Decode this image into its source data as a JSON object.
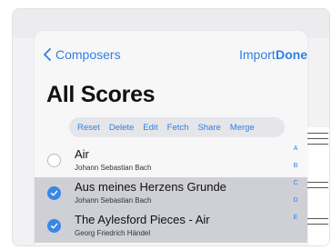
{
  "nav": {
    "back_label": "Composers",
    "import_label": "Import",
    "done_label": "Done"
  },
  "title": "All Scores",
  "toolbar": [
    "Reset",
    "Delete",
    "Edit",
    "Fetch",
    "Share",
    "Merge"
  ],
  "rows": [
    {
      "title": "Air",
      "subtitle": "Johann Sebastian Bach",
      "selected": false
    },
    {
      "title": "Aus meines Herzens Grunde",
      "subtitle": "Johann Sebastian Bach",
      "selected": true
    },
    {
      "title": "The Aylesford Pieces - Air",
      "subtitle": "Georg Friedrich Händel",
      "selected": true
    }
  ],
  "index_letters": [
    "A",
    "B",
    "C",
    "D",
    "E"
  ],
  "colors": {
    "accent": "#2f7fe0",
    "selected_row": "#cfd0d6",
    "check": "#3a86e6"
  }
}
